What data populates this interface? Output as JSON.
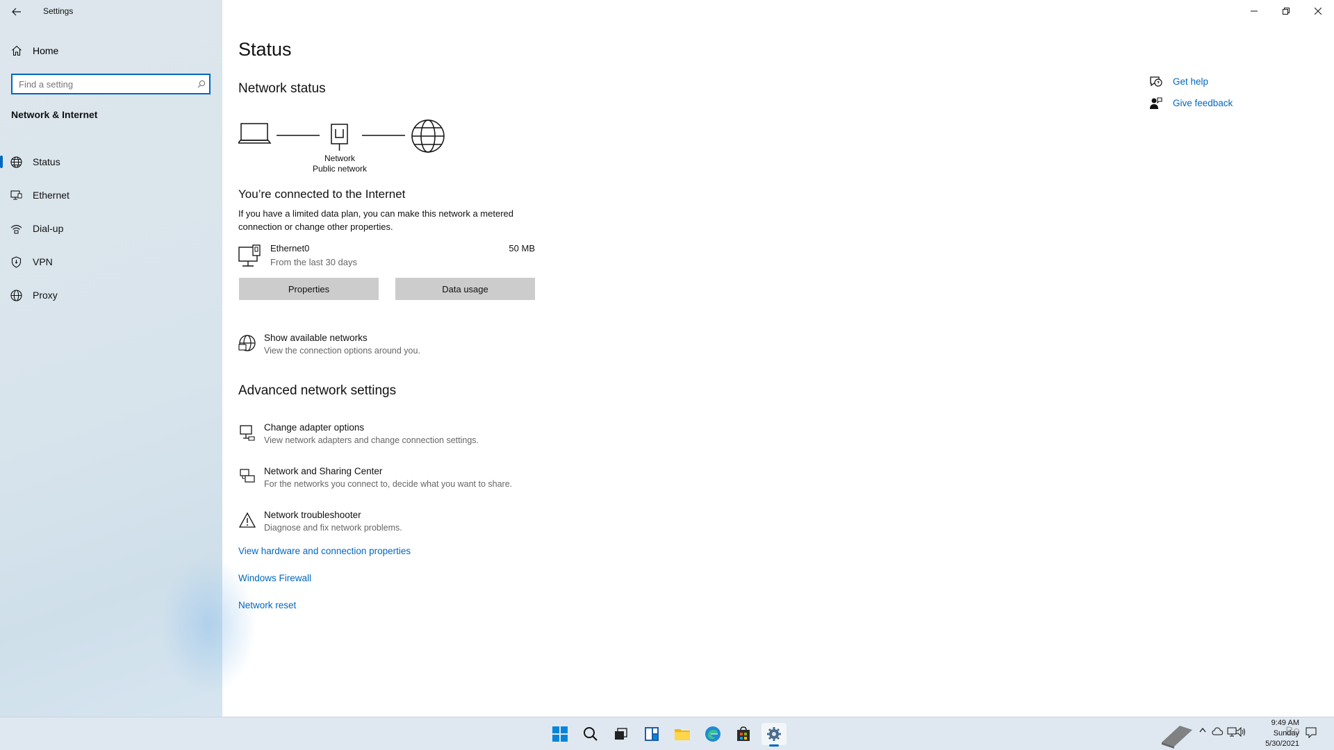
{
  "window": {
    "title": "Settings"
  },
  "sidebar": {
    "home_label": "Home",
    "search_placeholder": "Find a setting",
    "section_header": "Network & Internet",
    "items": [
      {
        "label": "Status",
        "icon": "globe-icon",
        "active": true
      },
      {
        "label": "Ethernet",
        "icon": "ethernet-icon",
        "active": false
      },
      {
        "label": "Dial-up",
        "icon": "dialup-icon",
        "active": false
      },
      {
        "label": "VPN",
        "icon": "vpn-icon",
        "active": false
      },
      {
        "label": "Proxy",
        "icon": "proxy-icon",
        "active": false
      }
    ]
  },
  "main": {
    "title": "Status",
    "network_status_heading": "Network status",
    "diagram": {
      "network_label": "Network",
      "network_type": "Public network"
    },
    "connected_title": "You’re connected to the Internet",
    "connected_desc": "If you have a limited data plan, you can make this network a metered connection or change other properties.",
    "adapter": {
      "name": "Ethernet0",
      "period": "From the last 30 days",
      "usage": "50 MB"
    },
    "buttons": {
      "properties": "Properties",
      "data_usage": "Data usage"
    },
    "show_networks": {
      "title": "Show available networks",
      "desc": "View the connection options around you."
    },
    "advanced_heading": "Advanced network settings",
    "advanced_items": [
      {
        "title": "Change adapter options",
        "desc": "View network adapters and change connection settings."
      },
      {
        "title": "Network and Sharing Center",
        "desc": "For the networks you connect to, decide what you want to share."
      },
      {
        "title": "Network troubleshooter",
        "desc": "Diagnose and fix network problems."
      }
    ],
    "links": {
      "hardware": "View hardware and connection properties",
      "firewall": "Windows Firewall",
      "reset": "Network reset"
    }
  },
  "help": {
    "get_help": "Get help",
    "give_feedback": "Give feedback"
  },
  "taskbar": {
    "time": "9:49 AM",
    "day": "Sunday",
    "date": "5/30/2021",
    "watermark": "Bo"
  },
  "colors": {
    "accent": "#0067c0",
    "sidebar_bg": "#dde6ec",
    "button_bg": "#cccccc"
  }
}
